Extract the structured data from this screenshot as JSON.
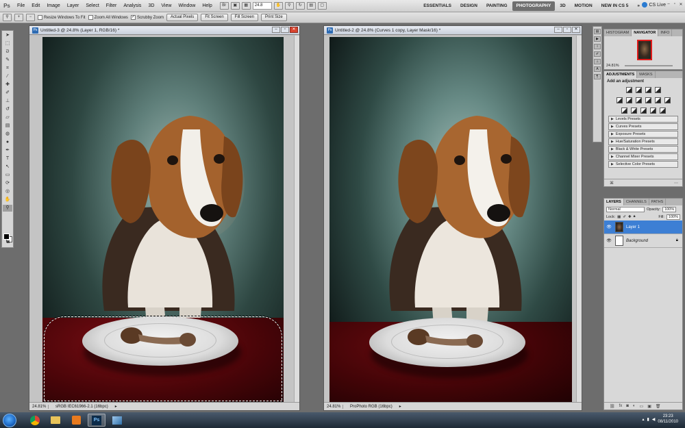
{
  "app": {
    "logo": "Ps",
    "menus": [
      "File",
      "Edit",
      "Image",
      "Layer",
      "Select",
      "Filter",
      "Analysis",
      "3D",
      "View",
      "Window",
      "Help"
    ],
    "zoom_field": "24.8",
    "workspaces": [
      "ESSENTIALS",
      "DESIGN",
      "PAINTING",
      "PHOTOGRAPHY",
      "3D",
      "MOTION",
      "NEW IN CS 5"
    ],
    "active_workspace": "PHOTOGRAPHY",
    "cs_live": "CS Live"
  },
  "options": {
    "resize_windows": "Resize Windows To Fit",
    "zoom_all": "Zoom All Windows",
    "scrubby_zoom": "Scrubby Zoom",
    "buttons": [
      "Actual Pixels",
      "Fit Screen",
      "Fill Screen",
      "Print Size"
    ]
  },
  "doc1": {
    "title": "Untitled-3 @ 24.8% (Layer 1, RGB/16) *",
    "zoom": "24.81%",
    "profile": "sRGB IEC61966-2.1 (16bpc)"
  },
  "doc2": {
    "title": "Untitled-2 @ 24.8% (Curves 1 copy, Layer Mask/16) *",
    "zoom": "24.81%",
    "profile": "ProPhoto RGB (16bpc)"
  },
  "navigator": {
    "tabs": [
      "HISTOGRAM",
      "NAVIGATOR",
      "INFO"
    ],
    "active": "NAVIGATOR",
    "zoom": "24.81%"
  },
  "adjustments": {
    "tabs": [
      "ADJUSTMENTS",
      "MASKS"
    ],
    "active": "ADJUSTMENTS",
    "heading": "Add an adjustment",
    "presets": [
      "Levels Presets",
      "Curves Presets",
      "Exposure Presets",
      "Hue/Saturation Presets",
      "Black & White Presets",
      "Channel Mixer Presets",
      "Selective Color Presets"
    ]
  },
  "layers": {
    "tabs": [
      "LAYERS",
      "CHANNELS",
      "PATHS"
    ],
    "active": "LAYERS",
    "blend_mode": "Normal",
    "opacity_label": "Opacity:",
    "opacity": "100%",
    "lock_label": "Lock:",
    "fill_label": "Fill:",
    "fill": "100%",
    "items": [
      {
        "name": "Layer 1",
        "selected": true
      },
      {
        "name": "Background",
        "selected": false
      }
    ]
  },
  "taskbar": {
    "time": "23:23",
    "date": "08/11/2010"
  },
  "colors": {
    "accent_selected": "#3d7fd4",
    "tablecloth": "#5a070c",
    "backdrop": "#2e4742"
  }
}
